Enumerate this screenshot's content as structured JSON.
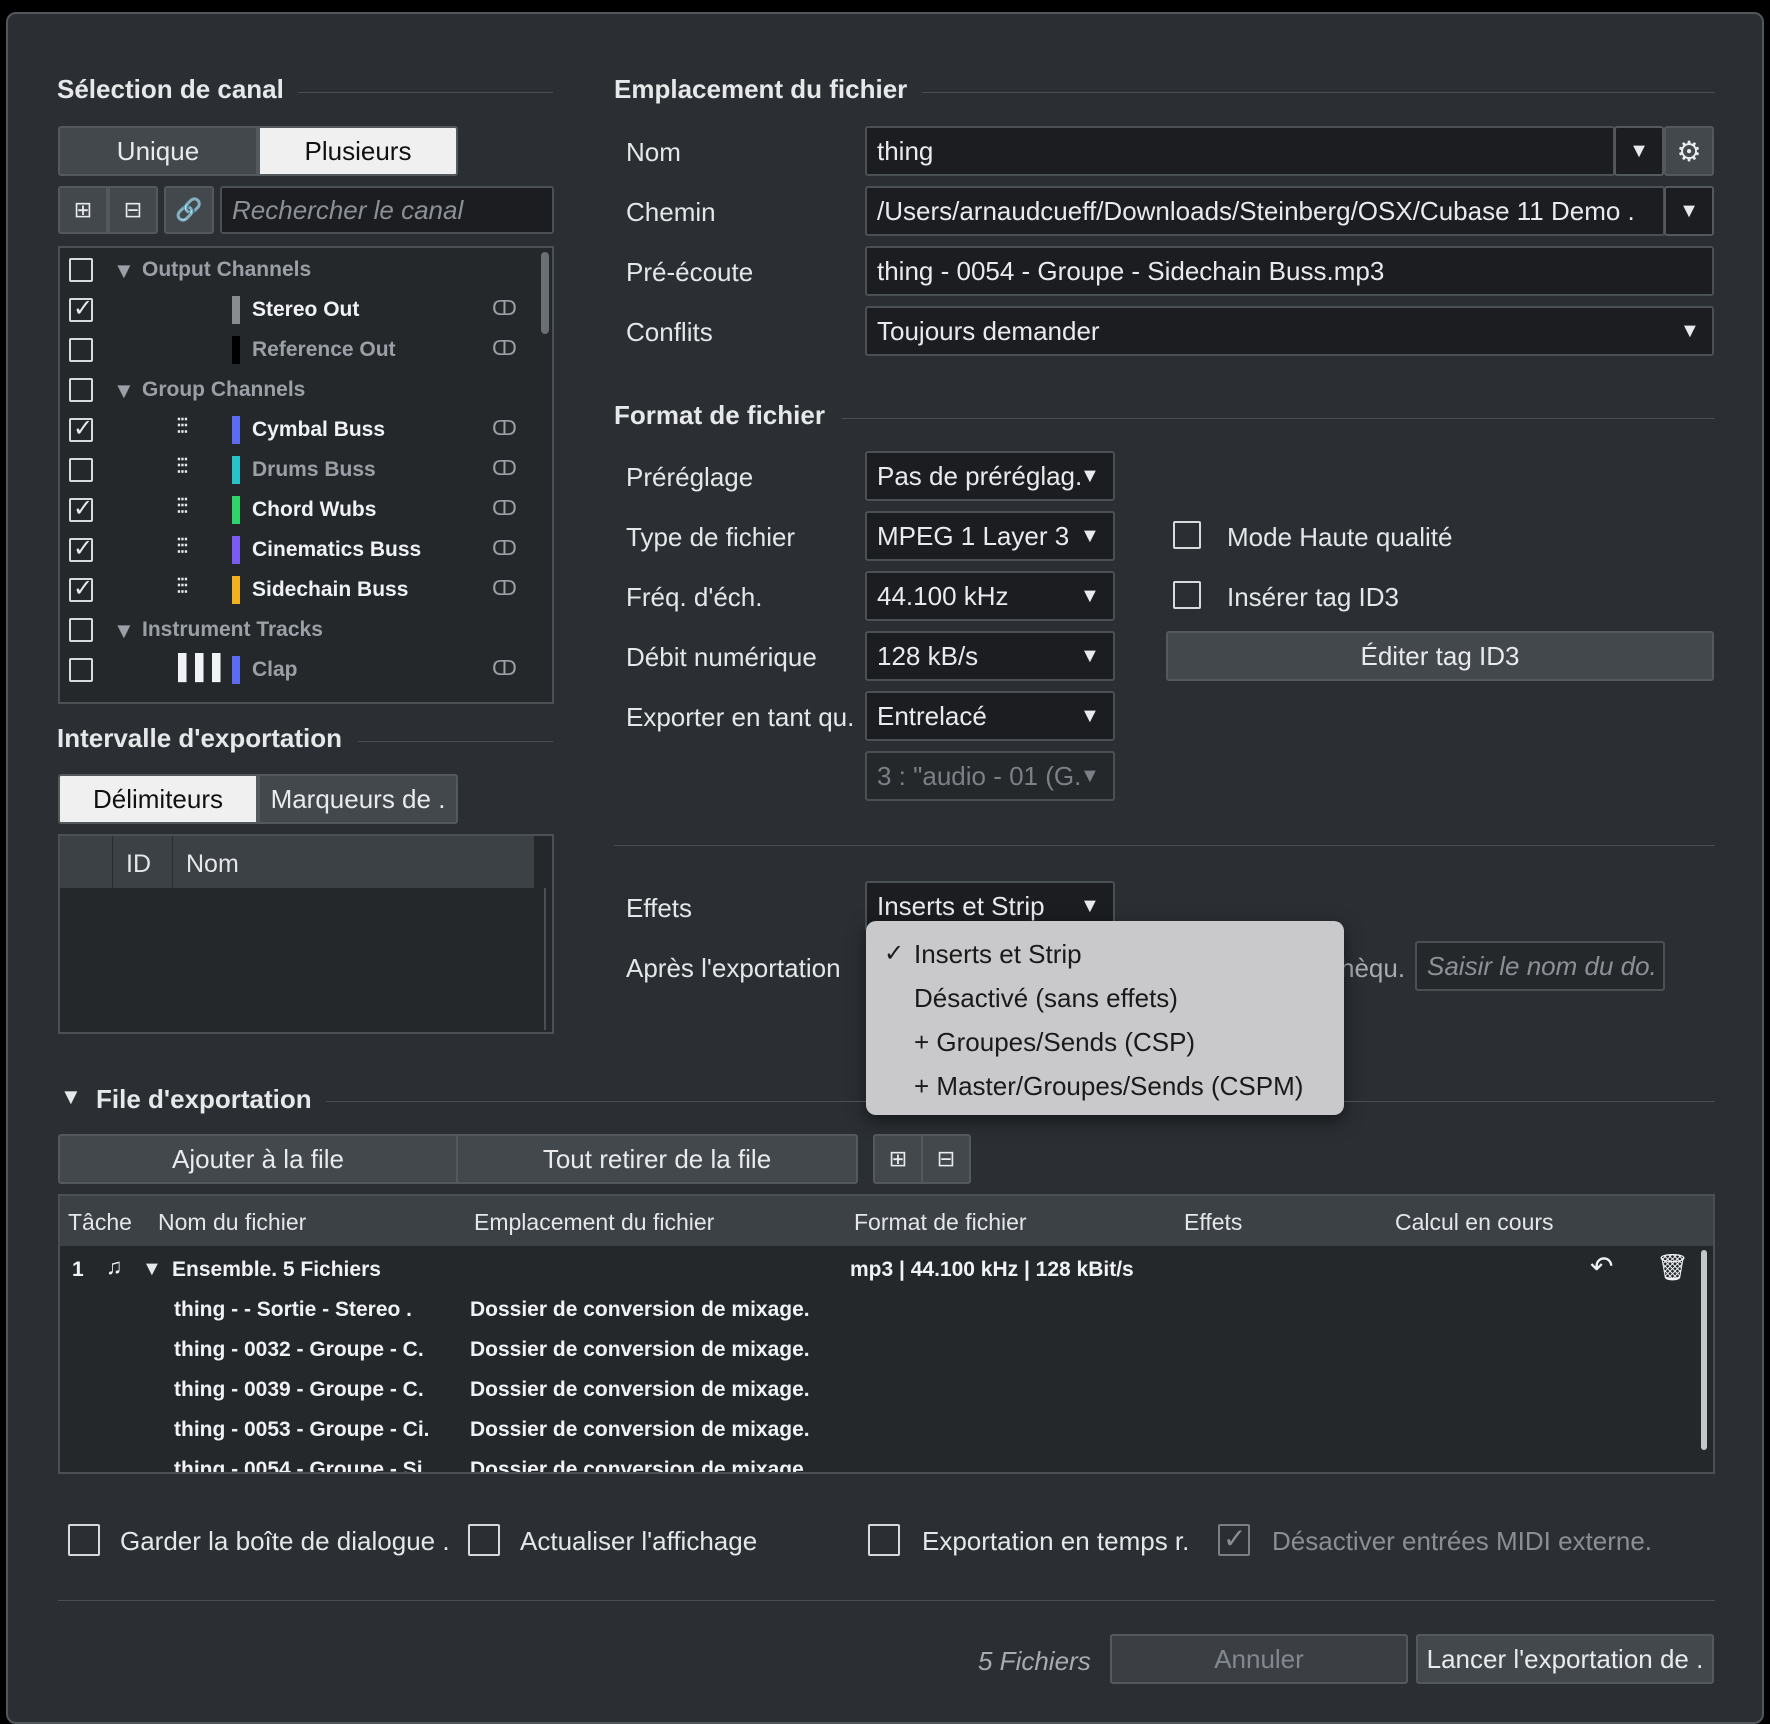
{
  "channel_selection": {
    "title": "Sélection de canal",
    "mode_unique": "Unique",
    "mode_multiple": "Plusieurs",
    "search_placeholder": "Rechercher le canal",
    "tree": [
      {
        "label": "Output Channels",
        "type": "folder",
        "checked": false
      },
      {
        "label": "Stereo Out",
        "type": "channel",
        "checked": true,
        "color": "#8a8d90"
      },
      {
        "label": "Reference Out",
        "type": "channel",
        "checked": false,
        "color": "#000000"
      },
      {
        "label": "Group Channels",
        "type": "folder",
        "checked": false
      },
      {
        "label": "Cymbal Buss",
        "type": "channel",
        "checked": true,
        "color": "#5b6cf0"
      },
      {
        "label": "Drums Buss",
        "type": "channel",
        "checked": false,
        "color": "#28c3c8"
      },
      {
        "label": "Chord Wubs",
        "type": "channel",
        "checked": true,
        "color": "#2fd46a"
      },
      {
        "label": "Cinematics Buss",
        "type": "channel",
        "checked": true,
        "color": "#7a5cf0"
      },
      {
        "label": "Sidechain Buss",
        "type": "channel",
        "checked": true,
        "color": "#f0b020"
      },
      {
        "label": "Instrument Tracks",
        "type": "folder",
        "checked": false
      },
      {
        "label": "Clap",
        "type": "channel",
        "checked": false,
        "color": "#5b6cf0"
      }
    ]
  },
  "export_range": {
    "title": "Intervalle d'exportation",
    "tab_delimiters": "Délimiteurs",
    "tab_markers": "Marqueurs de .",
    "col_id": "ID",
    "col_name": "Nom"
  },
  "file_location": {
    "title": "Emplacement du fichier",
    "name_label": "Nom",
    "name_value": "thing",
    "path_label": "Chemin",
    "path_value": "/Users/arnaudcueff/Downloads/Steinberg/OSX/Cubase 11 Demo .",
    "preview_label": "Pré-écoute",
    "preview_value": "thing - 0054 - Groupe - Sidechain Buss.mp3",
    "conflicts_label": "Conflits",
    "conflicts_value": "Toujours demander"
  },
  "file_format": {
    "title": "Format de fichier",
    "preset_label": "Préréglage",
    "preset_value": "Pas de préréglag.",
    "type_label": "Type de fichier",
    "type_value": "MPEG 1 Layer 3",
    "rate_label": "Fréq. d'éch.",
    "rate_value": "44.100 kHz",
    "bitrate_label": "Débit numérique",
    "bitrate_value": "128 kB/s",
    "export_as_label": "Exporter en tant qu.",
    "export_as_value": "Entrelacé",
    "track_value": "3 : \"audio - 01 (G.",
    "high_quality": "Mode Haute qualité",
    "insert_id3": "Insérer tag ID3",
    "edit_id3": "Éditer tag ID3"
  },
  "effects": {
    "label": "Effets",
    "value": "Inserts et Strip",
    "after_label": "Après l'exportation",
    "after_suffix": "hèqu.",
    "folder_placeholder": "Saisir le nom du do.",
    "menu": [
      {
        "label": "Inserts et Strip",
        "checked": true
      },
      {
        "label": "Désactivé (sans effets)",
        "checked": false
      },
      {
        "label": "+ Groupes/Sends (CSP)",
        "checked": false
      },
      {
        "label": "+ Master/Groupes/Sends (CSPM)",
        "checked": false
      }
    ]
  },
  "queue": {
    "title": "File d'exportation",
    "add_button": "Ajouter à la file",
    "remove_button": "Tout retirer de la file",
    "columns": [
      "Tâche",
      "Nom du fichier",
      "Emplacement du fichier",
      "Format de fichier",
      "Effets",
      "Calcul en cours"
    ],
    "job_number": "1",
    "job_name": "Ensemble. 5 Fichiers",
    "job_format": "mp3 | 44.100 kHz | 128 kBit/s",
    "files": [
      {
        "name": "thing -  - Sortie - Stereo .",
        "location": "Dossier de conversion de mixage."
      },
      {
        "name": "thing - 0032 - Groupe - C.",
        "location": "Dossier de conversion de mixage."
      },
      {
        "name": "thing - 0039 - Groupe - C.",
        "location": "Dossier de conversion de mixage."
      },
      {
        "name": "thing - 0053 - Groupe - Ci.",
        "location": "Dossier de conversion de mixage."
      },
      {
        "name": "thing - 0054 - Groupe - Si.",
        "location": "Dossier de conversion de mixage."
      }
    ]
  },
  "footer": {
    "keep_dialog": "Garder la boîte de dialogue .",
    "refresh_display": "Actualiser l'affichage",
    "realtime_export": "Exportation en temps r.",
    "disable_midi": "Désactiver entrées MIDI externe.",
    "file_count": "5 Fichiers",
    "cancel": "Annuler",
    "start_export": "Lancer l'exportation de ."
  },
  "icons": [
    "settings-gear-icon",
    "link-icon",
    "mixer-icon",
    "keyboard-icon",
    "stereo-link-icon",
    "undo-icon",
    "trash-icon",
    "music-file-icon"
  ]
}
